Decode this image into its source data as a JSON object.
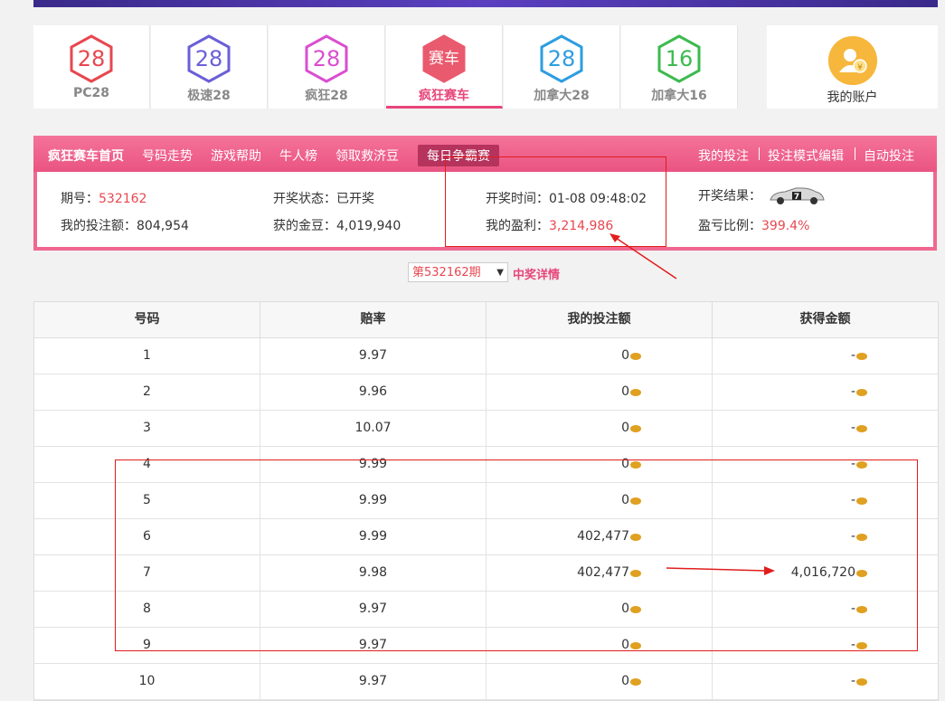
{
  "game_tabs": [
    {
      "num": "28",
      "label": "PC28",
      "color": "#e8474f"
    },
    {
      "num": "28",
      "label": "极速28",
      "color": "#6b5fd8"
    },
    {
      "num": "28",
      "label": "疯狂28",
      "color": "#d94fd0"
    },
    {
      "num": "赛车",
      "label": "疯狂赛车",
      "color": "#ea5a6e",
      "active": true
    },
    {
      "num": "28",
      "label": "加拿大28",
      "color": "#2e9de0"
    },
    {
      "num": "16",
      "label": "加拿大16",
      "color": "#3dba4e"
    }
  ],
  "account": {
    "label": "我的账户",
    "icon": "user-coin-icon"
  },
  "nav": {
    "home": "疯狂赛车首页",
    "trend": "号码走势",
    "help": "游戏帮助",
    "ranking": "牛人榜",
    "relief": "领取救济豆",
    "daily": "每日争霸赛",
    "my_bets": "我的投注",
    "bet_mode": "投注模式编辑",
    "auto_bet": "自动投注"
  },
  "info": {
    "period_label": "期号：",
    "period": "532162",
    "status_label": "开奖状态：",
    "status": "已开奖",
    "time_label": "开奖时间：",
    "time": "01-08 09:48:02",
    "result_label": "开奖结果：",
    "bet_label": "我的投注额：",
    "bet": "804,954",
    "gold_label": "获的金豆：",
    "gold": "4,019,940",
    "profit_label": "我的盈利：",
    "profit": "3,214,986",
    "ratio_label": "盈亏比例：",
    "ratio": "399.4%"
  },
  "period_select": {
    "value": "第532162期"
  },
  "detail_link": "中奖详情",
  "table": {
    "headers": [
      "号码",
      "赔率",
      "我的投注额",
      "获得金额"
    ],
    "rows": [
      {
        "num": "1",
        "odds": "9.97",
        "bet": "0",
        "win": "-"
      },
      {
        "num": "2",
        "odds": "9.96",
        "bet": "0",
        "win": "-"
      },
      {
        "num": "3",
        "odds": "10.07",
        "bet": "0",
        "win": "-"
      },
      {
        "num": "4",
        "odds": "9.99",
        "bet": "0",
        "win": "-"
      },
      {
        "num": "5",
        "odds": "9.99",
        "bet": "0",
        "win": "-"
      },
      {
        "num": "6",
        "odds": "9.99",
        "bet": "402,477",
        "win": "-"
      },
      {
        "num": "7",
        "odds": "9.98",
        "bet": "402,477",
        "win": "4,016,720"
      },
      {
        "num": "8",
        "odds": "9.97",
        "bet": "0",
        "win": "-"
      },
      {
        "num": "9",
        "odds": "9.97",
        "bet": "0",
        "win": "-"
      },
      {
        "num": "10",
        "odds": "9.97",
        "bet": "0",
        "win": "-"
      }
    ]
  }
}
